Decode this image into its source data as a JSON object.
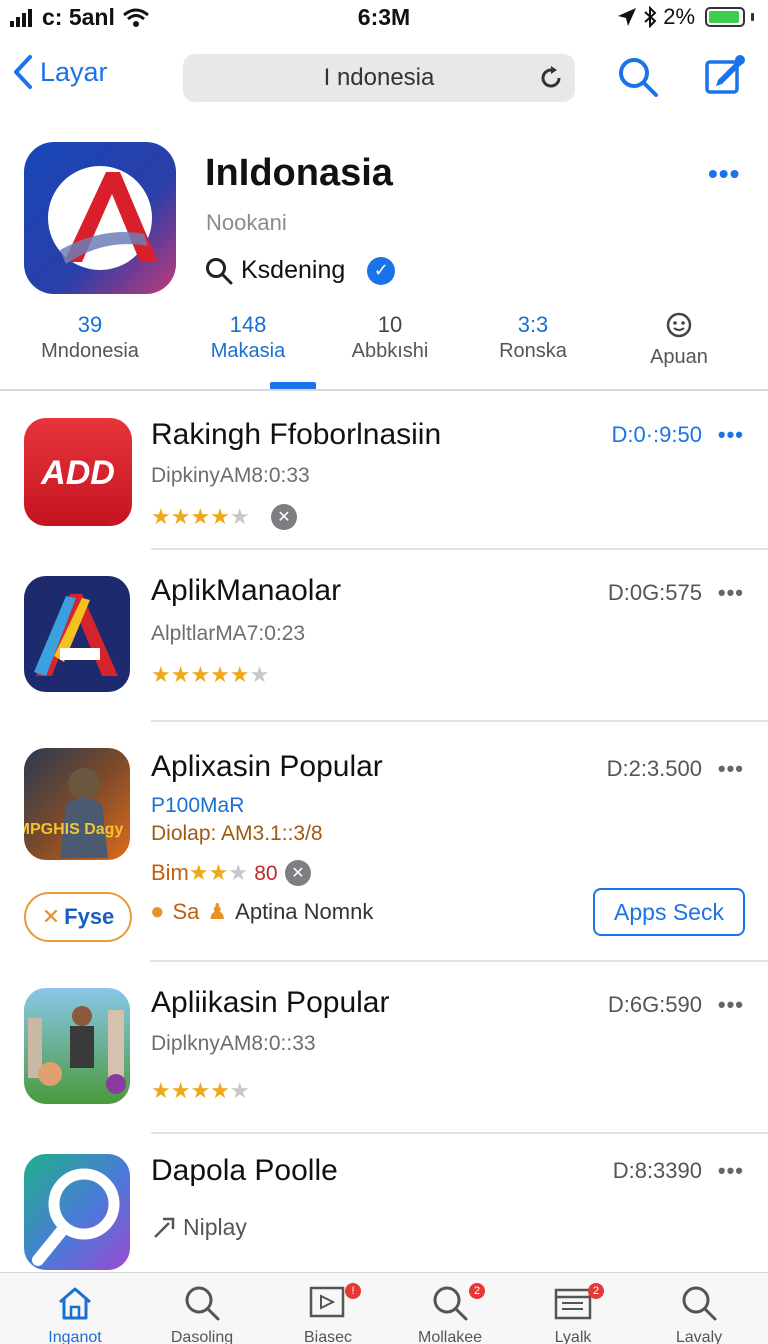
{
  "status": {
    "carrier": "c: 5anl",
    "time": "6:3M",
    "battery": "2%"
  },
  "nav": {
    "back_label": "Layar",
    "search_text": "I ndonesia"
  },
  "app": {
    "title": "InIdonasia",
    "subtitle": "Nookani",
    "meta": "Ksdening"
  },
  "stats": [
    {
      "value": "39",
      "label": "Mndonesia"
    },
    {
      "value": "148",
      "label": "Makasia"
    },
    {
      "value": "10",
      "label": "Abbkıshi"
    },
    {
      "value": "3:3",
      "label": "Ronska"
    },
    {
      "value": "",
      "label": "Apuan"
    }
  ],
  "rows": [
    {
      "title": "Rakingh Ffoborlnasiin",
      "sub": "DipkinyAM8:0:33",
      "price": "D:0·:9:50",
      "rating": 4,
      "icon_text": "ADD"
    },
    {
      "title": "AplikManaolar",
      "sub": "AlpltlarMA7:0:23",
      "price": "D:0G:575",
      "rating": 5
    },
    {
      "title": "Aplixasin Popular",
      "sub_blue": "P100MaR",
      "sub_orange": "Diolap: AM3.1::3/8",
      "price": "D:2:3.500",
      "rating_prefix": "Bim",
      "rating_suffix": "80",
      "icon_text": "MPGHIS Dagy",
      "pill_label": "Fyse",
      "promo_num": "Sa",
      "promo_text": "Aptina Nomnk",
      "action_label": "Apps Seck"
    },
    {
      "title": "Apliikasin Popular",
      "sub": "DiplknyAM8:0::33",
      "price": "D:6G:590",
      "rating": 4
    },
    {
      "title": "Dapola Poolle",
      "sub": "Niplay",
      "price": "D:8:3390"
    }
  ],
  "tabs": [
    {
      "label": "Inganot",
      "icon": "home-icon"
    },
    {
      "label": "Dasoling",
      "icon": "search-icon"
    },
    {
      "label": "Biasec",
      "icon": "media-icon",
      "badge": "!"
    },
    {
      "label": "Mollakee",
      "icon": "search-icon",
      "badge": "2"
    },
    {
      "label": "Lyalk",
      "icon": "calendar-icon",
      "badge": "2"
    },
    {
      "label": "Lavaly",
      "icon": "search-icon"
    }
  ],
  "colors": {
    "accent": "#1a73e8",
    "star": "#f0a81a",
    "badge": "#e53935"
  }
}
